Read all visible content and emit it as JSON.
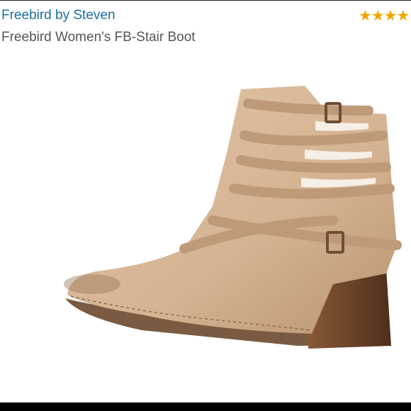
{
  "product": {
    "brand": "Freebird by Steven",
    "title": "Freebird Women's FB-Stair Boot",
    "rating_stars": "★★★★"
  },
  "colors": {
    "brand_link": "#1a6f9e",
    "star": "#f0a500",
    "leather": "#d2b08f",
    "heel": "#6b4328"
  },
  "icons": {
    "rating": "star-icon"
  }
}
